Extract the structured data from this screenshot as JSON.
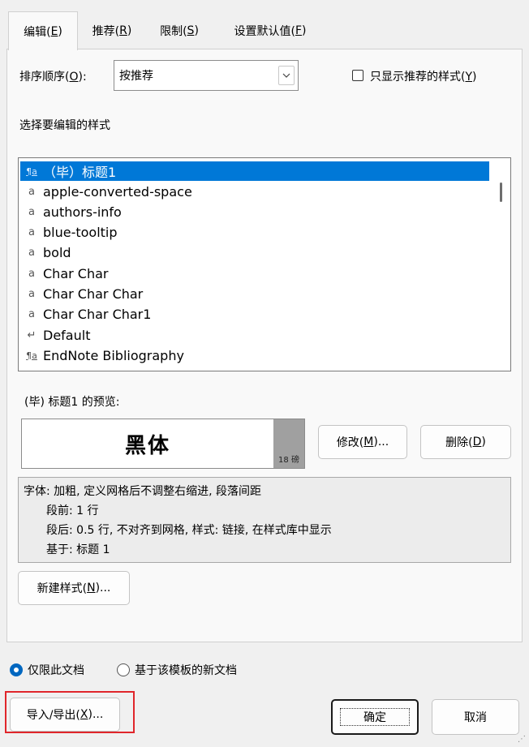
{
  "tabs": [
    {
      "label": "编辑(",
      "key": "E",
      "tail": ")"
    },
    {
      "label": "推荐(",
      "key": "R",
      "tail": ")"
    },
    {
      "label": "限制(",
      "key": "S",
      "tail": ")"
    },
    {
      "label": "设置默认值(",
      "key": "F",
      "tail": ")"
    }
  ],
  "sort": {
    "label_pre": "排序顺序(",
    "label_key": "O",
    "label_post": "):",
    "value": "按推荐"
  },
  "recommended_only": {
    "label_pre": "只显示推荐的样式(",
    "label_key": "Y",
    "label_post": ")",
    "checked": false
  },
  "style_list_label": "选择要编辑的样式",
  "style_list": [
    {
      "icon": "¶a",
      "text": "（毕）标题1",
      "selected": true
    },
    {
      "icon": "a",
      "text": "apple-converted-space"
    },
    {
      "icon": "a",
      "text": "authors-info"
    },
    {
      "icon": "a",
      "text": "blue-tooltip"
    },
    {
      "icon": "a",
      "text": "bold"
    },
    {
      "icon": "a",
      "text": "Char Char"
    },
    {
      "icon": "a",
      "text": "Char Char Char"
    },
    {
      "icon": "a",
      "text": "Char Char Char1"
    },
    {
      "icon": "↵",
      "text": "Default"
    },
    {
      "icon": "¶a",
      "text": "EndNote Bibliography"
    }
  ],
  "preview": {
    "label": "(毕) 标题1 的预览:",
    "sample_text": "黑体",
    "size": "18 磅"
  },
  "buttons": {
    "modify": {
      "pre": "修改(",
      "key": "M",
      "post": ")..."
    },
    "delete": {
      "pre": "删除(",
      "key": "D",
      "post": ")"
    },
    "new_style": {
      "pre": "新建样式(",
      "key": "N",
      "post": ")..."
    },
    "import_export": {
      "pre": "导入/导出(",
      "key": "X",
      "post": ")..."
    },
    "ok": "确定",
    "cancel": "取消"
  },
  "description": [
    "字体: 加粗, 定义网格后不调整右缩进, 段落间距",
    "段前: 1 行",
    "段后: 0.5 行, 不对齐到网格, 样式: 链接, 在样式库中显示",
    "基于: 标题 1"
  ],
  "scope": {
    "this_doc": "仅限此文档",
    "template": "基于该模板的新文档",
    "selected": "this_doc"
  },
  "colors": {
    "selection": "#0078d7",
    "radio": "#0067c0",
    "highlight_outline": "#e0262b"
  }
}
